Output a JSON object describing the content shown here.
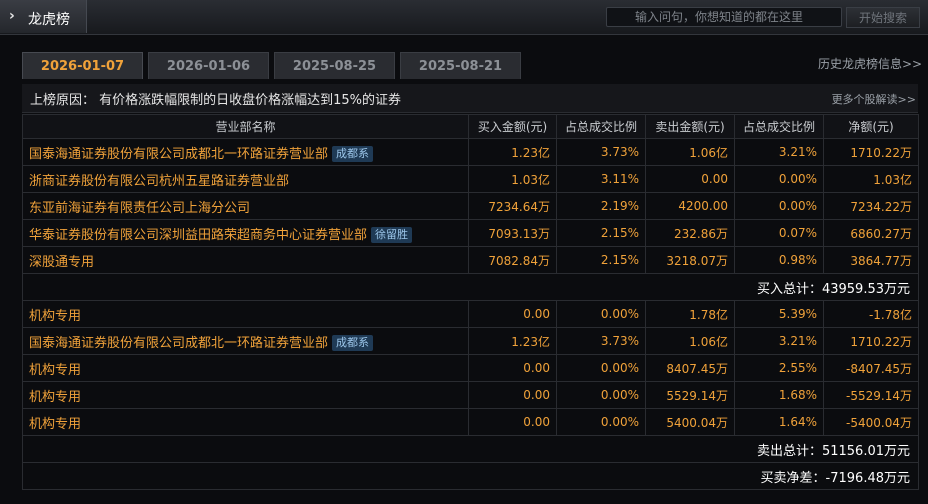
{
  "header": {
    "title": "龙虎榜"
  },
  "search": {
    "placeholder": "输入问句，你想知道的都在这里",
    "button_label": "开始搜索"
  },
  "tabs": [
    {
      "label": "2026-01-07",
      "active": true
    },
    {
      "label": "2026-01-06",
      "active": false
    },
    {
      "label": "2025-08-25",
      "active": false
    },
    {
      "label": "2025-08-21",
      "active": false
    }
  ],
  "history_link": "历史龙虎榜信息>>",
  "reason": {
    "text": "上榜原因：  有价格涨跌幅限制的日收盘价格涨幅达到15%的证券",
    "more": "更多个股解读>>"
  },
  "table": {
    "columns": [
      "营业部名称",
      "买入金额(元)",
      "占总成交比例",
      "卖出金额(元)",
      "占总成交比例",
      "净额(元)"
    ],
    "buy_rows": [
      {
        "name": "国泰海通证券股份有限公司成都北一环路证券营业部",
        "badge": "成都系",
        "buy": "1.23亿",
        "buy_pct": "3.73%",
        "sell": "1.06亿",
        "sell_pct": "3.21%",
        "net": "1710.22万"
      },
      {
        "name": "浙商证券股份有限公司杭州五星路证券营业部",
        "badge": "",
        "buy": "1.03亿",
        "buy_pct": "3.11%",
        "sell": "0.00",
        "sell_pct": "0.00%",
        "net": "1.03亿"
      },
      {
        "name": "东亚前海证券有限责任公司上海分公司",
        "badge": "",
        "buy": "7234.64万",
        "buy_pct": "2.19%",
        "sell": "4200.00",
        "sell_pct": "0.00%",
        "net": "7234.22万"
      },
      {
        "name": "华泰证券股份有限公司深圳益田路荣超商务中心证券营业部",
        "badge": "徐留胜",
        "buy": "7093.13万",
        "buy_pct": "2.15%",
        "sell": "232.86万",
        "sell_pct": "0.07%",
        "net": "6860.27万"
      },
      {
        "name": "深股通专用",
        "badge": "",
        "buy": "7082.84万",
        "buy_pct": "2.15%",
        "sell": "3218.07万",
        "sell_pct": "0.98%",
        "net": "3864.77万"
      }
    ],
    "buy_total": {
      "label": "买入总计：",
      "value": "43959.53万元"
    },
    "sell_rows": [
      {
        "name": "机构专用",
        "badge": "",
        "buy": "0.00",
        "buy_pct": "0.00%",
        "sell": "1.78亿",
        "sell_pct": "5.39%",
        "net": "-1.78亿"
      },
      {
        "name": "国泰海通证券股份有限公司成都北一环路证券营业部",
        "badge": "成都系",
        "buy": "1.23亿",
        "buy_pct": "3.73%",
        "sell": "1.06亿",
        "sell_pct": "3.21%",
        "net": "1710.22万"
      },
      {
        "name": "机构专用",
        "badge": "",
        "buy": "0.00",
        "buy_pct": "0.00%",
        "sell": "8407.45万",
        "sell_pct": "2.55%",
        "net": "-8407.45万"
      },
      {
        "name": "机构专用",
        "badge": "",
        "buy": "0.00",
        "buy_pct": "0.00%",
        "sell": "5529.14万",
        "sell_pct": "1.68%",
        "net": "-5529.14万"
      },
      {
        "name": "机构专用",
        "badge": "",
        "buy": "0.00",
        "buy_pct": "0.00%",
        "sell": "5400.04万",
        "sell_pct": "1.64%",
        "net": "-5400.04万"
      }
    ],
    "sell_total": {
      "label": "卖出总计：",
      "value": "51156.01万元"
    },
    "net_total": {
      "label": "买卖净差：",
      "value": "-7196.48万元"
    }
  }
}
